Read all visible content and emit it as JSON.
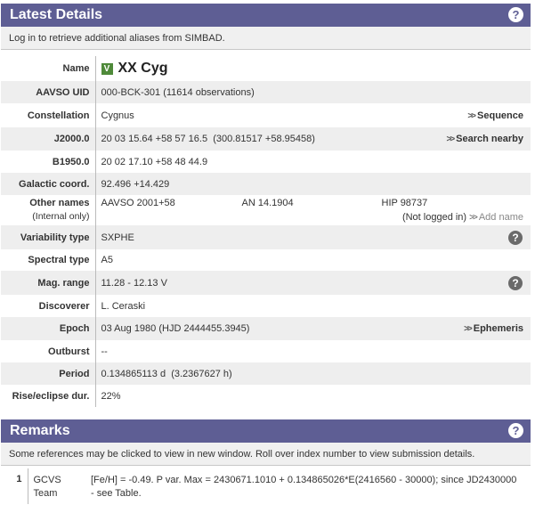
{
  "latest": {
    "title": "Latest Details",
    "help": "?",
    "note": "Log in to retrieve additional aliases from SIMBAD."
  },
  "rows": {
    "name": {
      "label": "Name",
      "badge": "V",
      "value": "XX Cyg"
    },
    "uid": {
      "label": "AAVSO UID",
      "value": "000-BCK-301 (11614 observations)"
    },
    "constellation": {
      "label": "Constellation",
      "value": "Cygnus",
      "link": "Sequence"
    },
    "j2000": {
      "label": "J2000.0",
      "value": "20 03 15.64 +58 57 16.5  (300.81517 +58.95458)",
      "link": "Search nearby"
    },
    "b1950": {
      "label": "B1950.0",
      "value": "20 02 17.10 +58 48 44.9"
    },
    "galactic": {
      "label": "Galactic coord.",
      "value": "92.496 +14.429"
    },
    "other": {
      "label": "Other names",
      "sublabel": "(Internal only)",
      "names": [
        "AAVSO 2001+58",
        "AN 14.1904",
        "HIP 98737"
      ],
      "login_note": "(Not logged in)",
      "add_link": "Add name"
    },
    "vartype": {
      "label": "Variability type",
      "value": "SXPHE"
    },
    "spectral": {
      "label": "Spectral type",
      "value": "A5"
    },
    "magrange": {
      "label": "Mag. range",
      "value": "11.28 - 12.13 V"
    },
    "discoverer": {
      "label": "Discoverer",
      "value": "L. Ceraski"
    },
    "epoch": {
      "label": "Epoch",
      "value": "03 Aug 1980 (HJD 2444455.3945)",
      "link": "Ephemeris"
    },
    "outburst": {
      "label": "Outburst",
      "value": "--"
    },
    "period": {
      "label": "Period",
      "value": "0.134865113 d  (3.2367627 h)"
    },
    "rise": {
      "label": "Rise/eclipse dur.",
      "value": "22%"
    }
  },
  "remarks": {
    "title": "Remarks",
    "help": "?",
    "note": "Some references may be clicked to view in new window. Roll over index number to view submission details.",
    "items": [
      {
        "index": "1",
        "source_line1": "GCVS",
        "source_line2": "Team",
        "text": "[Fe/H] = -0.49. P var. Max = 2430671.1010 + 0.134865026*E(2416560 - 30000); since JD2430000 - see Table."
      }
    ]
  }
}
